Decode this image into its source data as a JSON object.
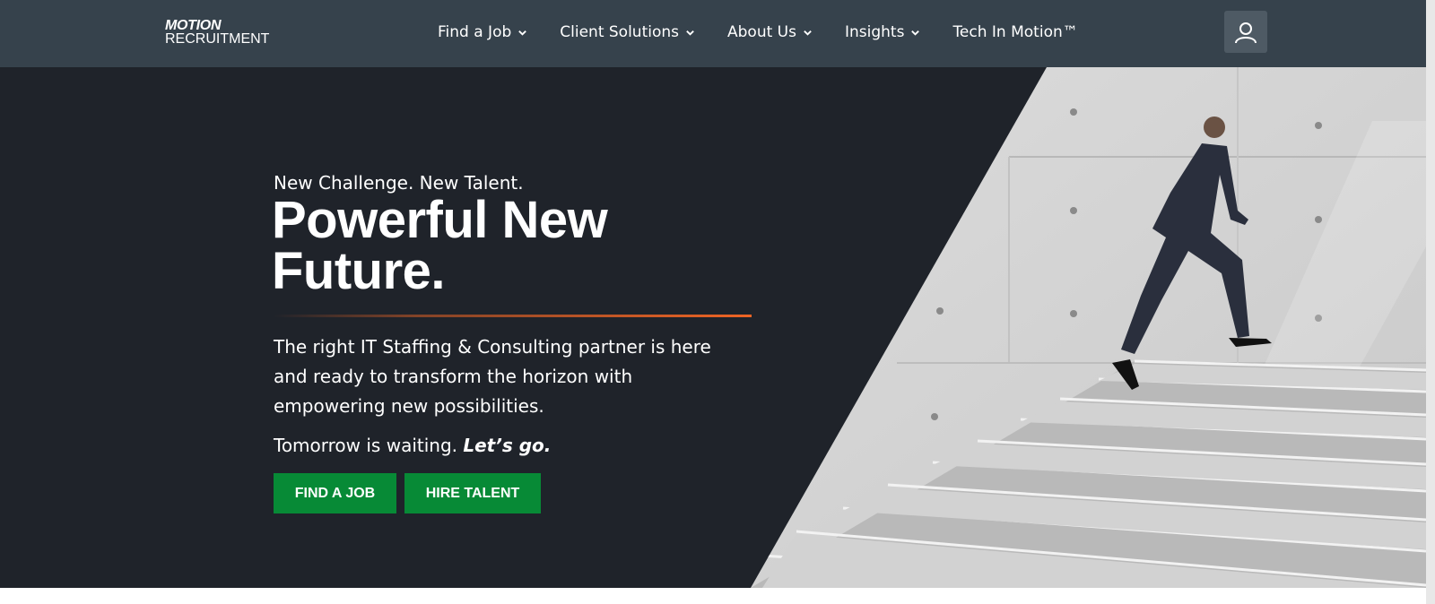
{
  "header": {
    "logo": {
      "line1": "MOTION",
      "line2": "RECRUITMENT"
    },
    "nav": [
      {
        "label": "Find a Job",
        "has_dropdown": true
      },
      {
        "label": "Client Solutions",
        "has_dropdown": true
      },
      {
        "label": "About Us",
        "has_dropdown": true
      },
      {
        "label": "Insights",
        "has_dropdown": true
      },
      {
        "label": "Tech In Motion™",
        "has_dropdown": false
      }
    ],
    "user_icon": "user-icon"
  },
  "hero": {
    "eyebrow": "New Challenge. New Talent.",
    "headline_line1": "Powerful New",
    "headline_line2": "Future.",
    "description": "The right IT Staffing & Consulting partner is here and ready to transform the horizon with empowering new possibilities.",
    "tagline_plain": "Tomorrow is waiting.",
    "tagline_emphasis": "Let’s go.",
    "buttons": {
      "find_job": "FIND A JOB",
      "hire_talent": "HIRE TALENT"
    },
    "image": "man in suit running up concrete stairs"
  },
  "colors": {
    "header_bg": "#36424c",
    "hero_bg": "#1f232a",
    "accent_orange": "#ef6424",
    "button_green": "#078a36"
  }
}
